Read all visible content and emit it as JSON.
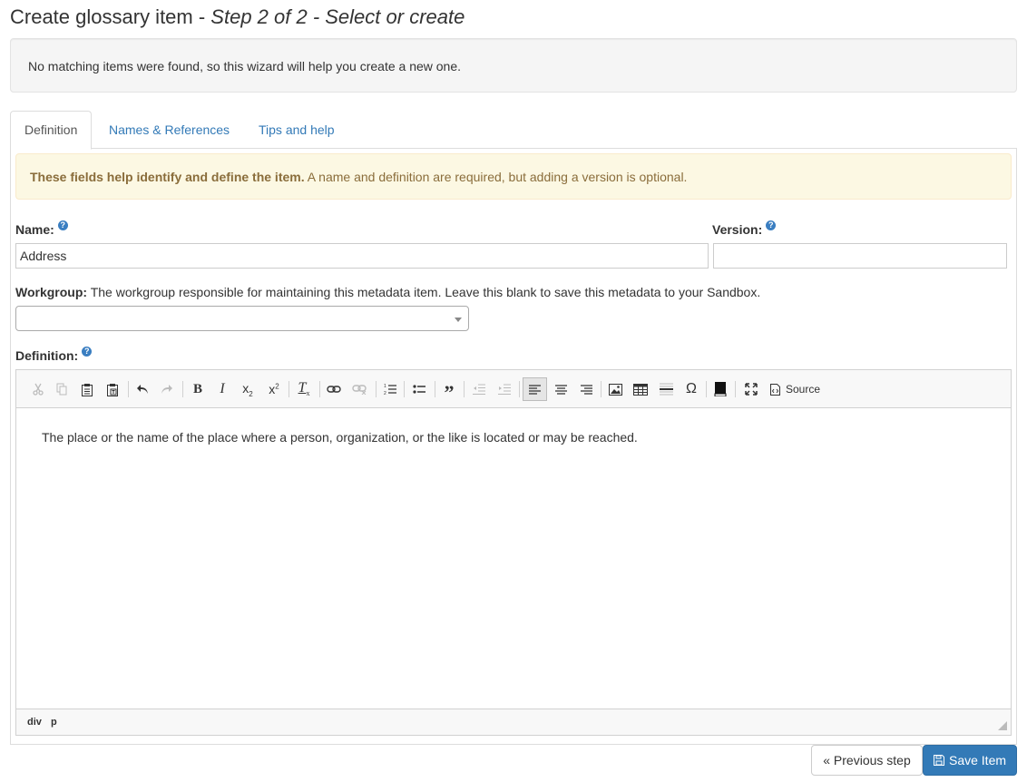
{
  "page": {
    "title_main": "Create glossary item - ",
    "title_step": "Step 2 of 2 - Select or create",
    "notice": "No matching items were found, so this wizard will help you create a new one."
  },
  "tabs": [
    {
      "label": "Definition",
      "active": true
    },
    {
      "label": "Names & References",
      "active": false
    },
    {
      "label": "Tips and help",
      "active": false
    }
  ],
  "info": {
    "bold": "These fields help identify and define the item.",
    "text": " A name and definition are required, but adding a version is optional."
  },
  "form": {
    "name_label": "Name:",
    "name_value": "Address",
    "version_label": "Version:",
    "version_value": "",
    "help_glyph": "?",
    "workgroup_label": "Workgroup:",
    "workgroup_desc": " The workgroup responsible for maintaining this metadata item. Leave this blank to save this metadata to your Sandbox.",
    "workgroup_value": "",
    "definition_label": "Definition:"
  },
  "editor": {
    "toolbar": {
      "cut_icon": "cut-icon",
      "copy_icon": "copy-icon",
      "source_label": "Source"
    },
    "content": "The place or the name of the place where a person, organization, or the like is located or may be reached.",
    "path": [
      "div",
      "p"
    ]
  },
  "buttons": {
    "previous": "« Previous step",
    "save": "Save Item"
  },
  "colors": {
    "primary": "#337ab7",
    "link": "#337ab7",
    "warning_bg": "#fcf8e3",
    "warning_text": "#8a6d3b",
    "help_icon": "#3a7ec1"
  }
}
